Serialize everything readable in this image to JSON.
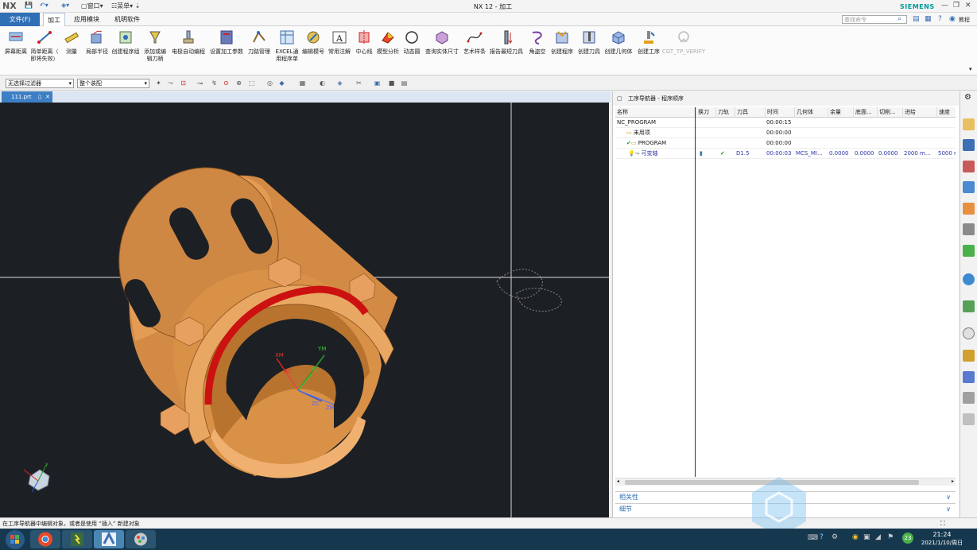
{
  "titlebar": {
    "logo": "NX",
    "window_label": "窗口",
    "menu_label": "菜单",
    "title": "NX 12 - 加工",
    "brand": "SIEMENS"
  },
  "menubar": {
    "file": "文件(F)",
    "tabs": [
      "加工",
      "应用模块",
      "机明软件"
    ],
    "command_search_placeholder": "查找命令",
    "help_label": "教程"
  },
  "ribbon": {
    "buttons": [
      {
        "label": "屏幕距离",
        "icon": "screen-distance-icon"
      },
      {
        "label": "简单距离（",
        "label2": "即将失效）",
        "icon": "simple-distance-icon"
      },
      {
        "label": "测量",
        "icon": "measure-icon"
      },
      {
        "label": "局部半径",
        "icon": "local-radius-icon"
      },
      {
        "label": "创建程序组",
        "icon": "create-program-group-icon"
      },
      {
        "label": "添加或编",
        "label2": "辑刀柄",
        "icon": "tool-holder-icon"
      },
      {
        "label": "电极自动编程",
        "icon": "electrode-icon"
      },
      {
        "label": "设置加工参数",
        "icon": "machining-params-icon"
      },
      {
        "label": "刀路管理",
        "icon": "toolpath-manage-icon"
      },
      {
        "label": "EXCEL通",
        "label2": "用程序单",
        "icon": "excel-icon"
      },
      {
        "label": "编辑模号",
        "icon": "edit-mold-number-icon"
      },
      {
        "label": "常用注解",
        "icon": "annotation-icon"
      },
      {
        "label": "中心线",
        "icon": "centerline-icon"
      },
      {
        "label": "模型分析",
        "icon": "model-analysis-icon"
      },
      {
        "label": "动态圆",
        "icon": "dynamic-circle-icon"
      },
      {
        "label": "查询实体尺寸",
        "icon": "query-size-icon"
      },
      {
        "label": "艺术样条",
        "icon": "spline-icon"
      },
      {
        "label": "报告最短刀具",
        "icon": "shortest-tool-icon"
      },
      {
        "label": "角盗空",
        "icon": "corner-icon"
      },
      {
        "label": "创建程序",
        "icon": "create-program-icon"
      },
      {
        "label": "创建刀具",
        "icon": "create-tool-icon"
      },
      {
        "label": "创建几何体",
        "icon": "create-geometry-icon"
      },
      {
        "label": "创建工序",
        "icon": "create-operation-icon"
      },
      {
        "label": "CGT_TP_VERIFY",
        "icon": "verify-icon",
        "disabled": true
      }
    ]
  },
  "filterbar": {
    "selection_filter": "无选择过滤器",
    "assembly_scope": "整个装配"
  },
  "document_tab": {
    "name": "111.prt"
  },
  "viewport": {
    "axis_labels": {
      "xm": "XM",
      "xc": "XC",
      "ym": "YM",
      "yc": "YC",
      "zc": "ZC",
      "zm": "ZM"
    },
    "triad_y": "Y"
  },
  "navigator": {
    "title": "工序导航器 - 程序顺序",
    "columns": [
      "名称",
      "换刀",
      "刀轨",
      "刀具",
      "时间",
      "几何体",
      "余量",
      "底面...",
      "切削...",
      "进给",
      "速度"
    ],
    "rows": [
      {
        "name": "NC_PROGRAM",
        "time": "00:00:15"
      },
      {
        "name": "未用项",
        "time": "00:00:00"
      },
      {
        "name": "PROGRAM",
        "time": "00:00:00"
      },
      {
        "name": "可变轴",
        "tool": "D1.5",
        "time": "00:00:03",
        "geometry": "MCS_MI...",
        "stock": "0.0000",
        "floor": "0.0000",
        "cut": "0.0000",
        "feed": "2000 m...",
        "speed": "5000 r"
      }
    ],
    "sections": [
      "相关性",
      "细节"
    ]
  },
  "statusbar": {
    "message": "在工序导航器中编辑对象，或者是使用 “插入” 新建对象"
  },
  "taskbar": {
    "time": "21:24",
    "date": "2021/1/10/周日",
    "badge": "23"
  },
  "colors": {
    "accent": "#2e6fb5",
    "part": "#d7904a",
    "toolpath": "#cc1111",
    "viewport_bg": "#1c2024"
  }
}
